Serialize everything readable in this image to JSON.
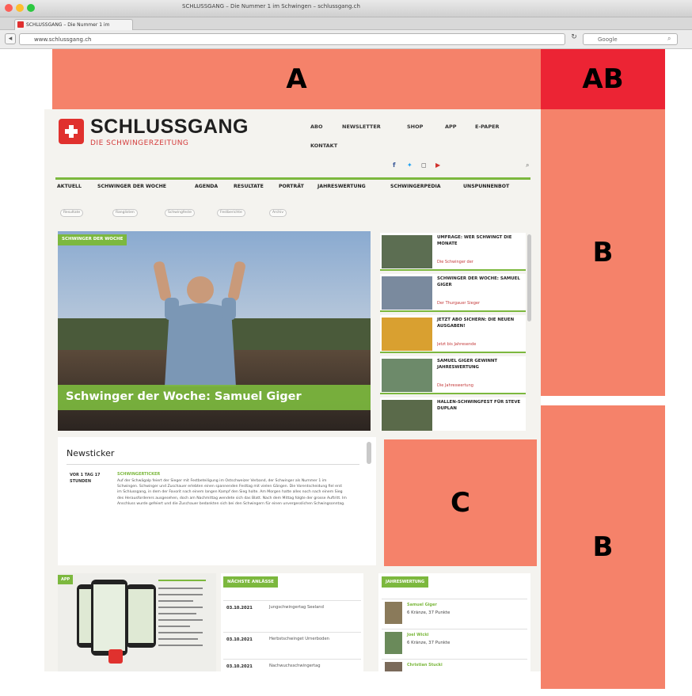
{
  "browser": {
    "window_title": "SCHLUSSGANG – Die Nummer 1 im Schwingen – schlussgang.ch",
    "tab_title": "SCHLUSSGANG – Die Nummer 1 im",
    "url": "www.schlussgang.ch",
    "search_placeholder": "Google"
  },
  "ads": {
    "a": "A",
    "ab": "AB",
    "b1": "B",
    "b2": "B",
    "c": "C"
  },
  "site": {
    "logo_text": "SCHLUSSGANG",
    "tagline": "DIE SCHWINGERZEITUNG",
    "top_menu": [
      "ABO",
      "NEWSLETTER",
      "SHOP",
      "APP",
      "E-PAPER",
      "KONTAKT"
    ],
    "social_icons": [
      "facebook-icon",
      "twitter-icon",
      "instagram-icon",
      "youtube-icon"
    ],
    "main_nav": [
      "AKTUELL",
      "SCHWINGER DER WOCHE",
      "AGENDA",
      "RESULTATE",
      "PORTRÄT",
      "JAHRESWERTUNG",
      "SCHWINGERPEDIA",
      "UNSPUNNENBOT"
    ],
    "sub_nav": [
      "Resultate",
      "Ranglisten",
      "Schwingfeste",
      "Festberichte",
      "Archiv"
    ]
  },
  "hero": {
    "tag": "SCHWINGER DER WOCHE",
    "caption": "Schwinger der Woche: Samuel Giger"
  },
  "side_list": [
    {
      "title": "UMFRAGE: WER SCHWINGT DIE MONATE",
      "sub": "Die Schwinger der"
    },
    {
      "title": "SCHWINGER DER WOCHE: SAMUEL GIGER",
      "sub": "Der Thurgauer Sieger"
    },
    {
      "title": "JETZT ABO SICHERN: DIE NEUEN AUSGABEN!",
      "sub": "Jetzt bis Jahresende"
    },
    {
      "title": "SAMUEL GIGER GEWINNT JAHRESWERTUNG",
      "sub": "Die Jahreswertung"
    },
    {
      "title": "HALLEN-SCHWINGFEST FÜR STEVE DUPLAN",
      "sub": ""
    }
  ],
  "newsticker": {
    "title": "Newsticker",
    "date": "VOR 1 TAG 17 STUNDEN",
    "headline": "SCHWINGERTICKER",
    "body": "Auf der Schwägalp feiert der Sieger mit Festbeteiligung im Ostschweizer Verband, der Schwinger als Nummer 1 im Schwingen. Schwinger und Zuschauer erlebten einen spannenden Festtag mit vielen Gängen. Die Vorentscheidung fiel erst im Schlussgang, in dem der Favorit nach einem langen Kampf den Sieg holte. Am Morgen hatte alles noch nach einem Sieg des Herausforderers ausgesehen, doch am Nachmittag wendete sich das Blatt. Nach dem Mittag folgte der grosse Auftritt. Im Anschluss wurde gefeiert und die Zuschauer bedankten sich bei den Schwingern für einen unvergesslichen Schwingsonntag."
  },
  "app": {
    "tag": "APP"
  },
  "dates": {
    "tag": "NÄCHSTE ANLÄSSE",
    "rows": [
      {
        "date": "03.10.2021",
        "event": "Jungschwingertag Seeland"
      },
      {
        "date": "03.10.2021",
        "event": "Herbstschwinget Urnerboden"
      },
      {
        "date": "03.10.2021",
        "event": "Nachwuchsschwingertag"
      }
    ]
  },
  "cal": {
    "tag": "JAHRESWERTUNG",
    "rows": [
      {
        "name": "Samuel Giger",
        "sub": "6 Kränze, 37 Punkte"
      },
      {
        "name": "Joel Wicki",
        "sub": "6 Kränze, 37 Punkte"
      },
      {
        "name": "Christian Stucki",
        "sub": ""
      }
    ]
  },
  "colors": {
    "accent_green": "#7cb83e",
    "brand_red": "#e0312e",
    "ad_salmon": "#f5826a",
    "ad_red": "#ec2434"
  }
}
